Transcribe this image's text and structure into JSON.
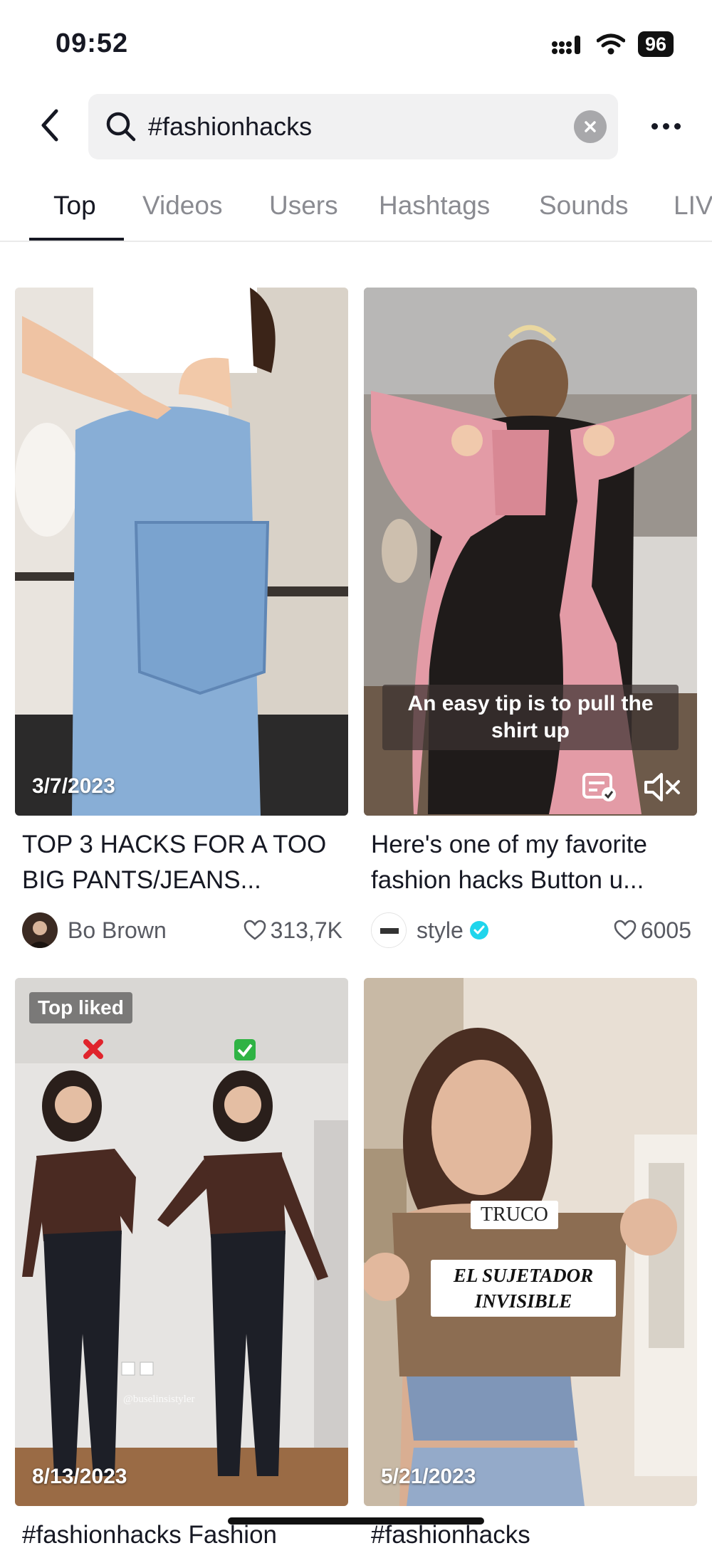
{
  "status": {
    "time": "09:52",
    "battery": "96"
  },
  "search": {
    "query": "#fashionhacks"
  },
  "tabs": [
    "Top",
    "Videos",
    "Users",
    "Hashtags",
    "Sounds",
    "LIVE"
  ],
  "results": [
    {
      "date": "3/7/2023",
      "caption": "TOP 3 HACKS FOR A TOO BIG PANTS/JEANS...",
      "author": "Bo Brown",
      "likes": "313,7K"
    },
    {
      "date": "",
      "overlay": "An easy tip is to pull the shirt up",
      "caption": "Here's one of my favorite fashion hacks Button u...",
      "author": "style",
      "verified": true,
      "likes": "6005"
    },
    {
      "badge": "Top liked",
      "watermark": "@buselinsistyler",
      "date": "8/13/2023",
      "caption": "#fashionhacks Fashion"
    },
    {
      "overlay_title": "TRUCO",
      "overlay_text": "EL SUJETADOR INVISIBLE",
      "date": "5/21/2023",
      "caption": "#fashionhacks"
    }
  ],
  "colors": {
    "verified": "#20d5ec",
    "no_mark": "#e0242c",
    "yes_mark": "#2fb344"
  }
}
